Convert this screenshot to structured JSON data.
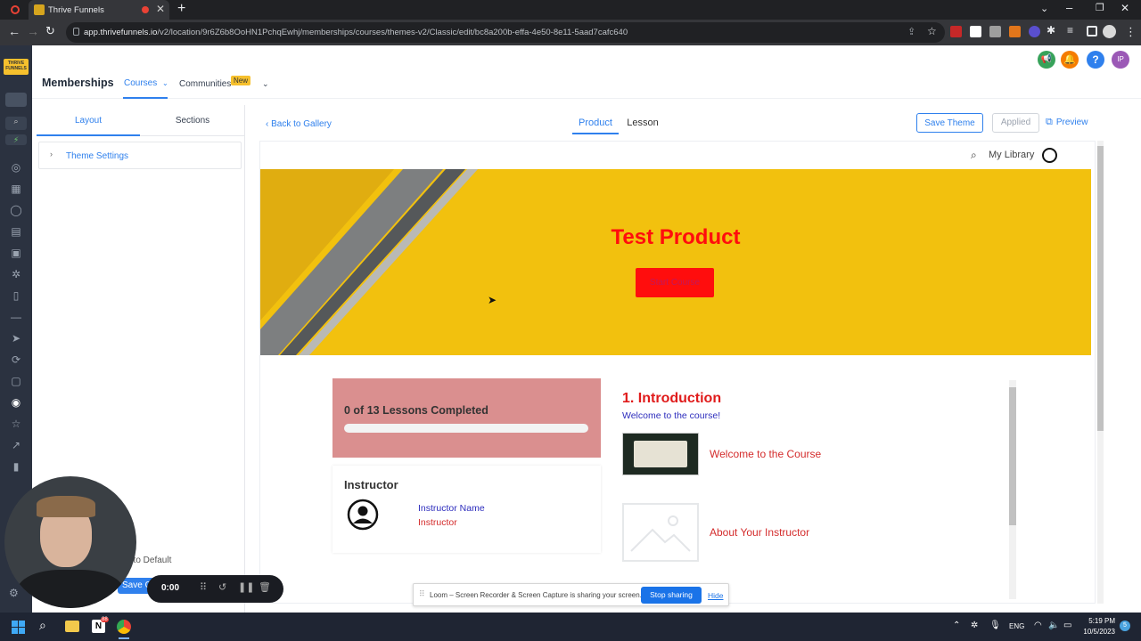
{
  "browser": {
    "tab_title": "Thrive Funnels",
    "url_domain": "app.thrivefunnels.io",
    "url_path": "/v2/location/9r6Z6b8OoHN1PchqEwhj/memberships/courses/themes-v2/Classic/edit/bc8a200b-effa-4e50-8e11-5aad7cafc640"
  },
  "app": {
    "logo_text": "THRIVE FUNNELS",
    "title": "Memberships",
    "nav": {
      "courses": "Courses",
      "communities": "Communities",
      "new_badge": "New"
    },
    "avatar_initials": "IP"
  },
  "left_panel": {
    "tabs": [
      "Layout",
      "Sections"
    ],
    "theme_settings": "Theme Settings",
    "reset_label": "t to Default",
    "save_label": "Save C"
  },
  "editor": {
    "back_link": "Back to Gallery",
    "tabs": [
      "Product",
      "Lesson"
    ],
    "save_theme": "Save Theme",
    "applied": "Applied",
    "preview": "Preview"
  },
  "site": {
    "my_library": "My Library",
    "hero_title": "Test Product",
    "hero_button": "Start Course",
    "progress_text": "0 of 13 Lessons Completed",
    "progress_fraction": 0,
    "instructor_heading": "Instructor",
    "instructor_name": "Instructor Name",
    "instructor_role": "Instructor",
    "section_title": "1. Introduction",
    "section_subtitle": "Welcome to the course!",
    "lessons": [
      "Welcome to the Course",
      "About Your Instructor"
    ]
  },
  "recorder": {
    "timer": "0:00"
  },
  "loom": {
    "message": "Loom – Screen Recorder & Screen Capture is sharing your screen.",
    "stop": "Stop sharing",
    "hide": "Hide"
  },
  "taskbar": {
    "lang": "ENG",
    "time": "5:19 PM",
    "date": "10/5/2023",
    "notif": "5",
    "notion_badge": "88"
  },
  "colors": {
    "accent": "#2f80ed",
    "hero_bg": "#f2c10e",
    "red": "#ff0d0d",
    "progress_bg": "#da8f8f",
    "sidebar": "#2b3240"
  }
}
